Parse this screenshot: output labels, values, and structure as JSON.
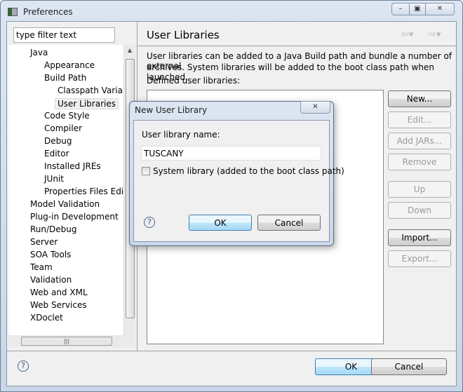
{
  "window": {
    "title": "Preferences",
    "controls": [
      "minimize",
      "maximize",
      "close"
    ]
  },
  "filter": {
    "placeholder": "type filter text",
    "value": "type filter text"
  },
  "tree": [
    {
      "label": "Java",
      "level": 1
    },
    {
      "label": "Appearance",
      "level": 2
    },
    {
      "label": "Build Path",
      "level": 2
    },
    {
      "label": "Classpath Variable",
      "level": 3
    },
    {
      "label": "User Libraries",
      "level": 3,
      "selected": true
    },
    {
      "label": "Code Style",
      "level": 2
    },
    {
      "label": "Compiler",
      "level": 2
    },
    {
      "label": "Debug",
      "level": 2
    },
    {
      "label": "Editor",
      "level": 2
    },
    {
      "label": "Installed JREs",
      "level": 2
    },
    {
      "label": "JUnit",
      "level": 2
    },
    {
      "label": "Properties Files Editor",
      "level": 2
    },
    {
      "label": "Model Validation",
      "level": 1
    },
    {
      "label": "Plug-in Development",
      "level": 1
    },
    {
      "label": "Run/Debug",
      "level": 1
    },
    {
      "label": "Server",
      "level": 1
    },
    {
      "label": "SOA Tools",
      "level": 1
    },
    {
      "label": "Team",
      "level": 1
    },
    {
      "label": "Validation",
      "level": 1
    },
    {
      "label": "Web and XML",
      "level": 1
    },
    {
      "label": "Web Services",
      "level": 1
    },
    {
      "label": "XDoclet",
      "level": 1
    }
  ],
  "page": {
    "title": "User Libraries",
    "description1": "User libraries can be added to a Java Build path and bundle a number of external",
    "description2": "archives. System libraries will be added to the boot class path when launched.",
    "list_label": "Defined user libraries:",
    "buttons": [
      {
        "label": "New...",
        "enabled": true
      },
      {
        "label": "Edit...",
        "enabled": false
      },
      {
        "label": "Add JARs...",
        "enabled": false
      },
      {
        "label": "Remove",
        "enabled": false
      },
      {
        "label": "Up",
        "enabled": false
      },
      {
        "label": "Down",
        "enabled": false
      },
      {
        "label": "Import...",
        "enabled": true
      },
      {
        "label": "Export...",
        "enabled": false
      }
    ]
  },
  "footer": {
    "ok": "OK",
    "cancel": "Cancel",
    "help": "?"
  },
  "dialog": {
    "title": "New User Library",
    "name_label": "User library name:",
    "name_value": "TUSCANY",
    "system_checkbox": "System library (added to the boot class path)",
    "system_checked": false,
    "ok": "OK",
    "cancel": "Cancel",
    "help": "?"
  }
}
